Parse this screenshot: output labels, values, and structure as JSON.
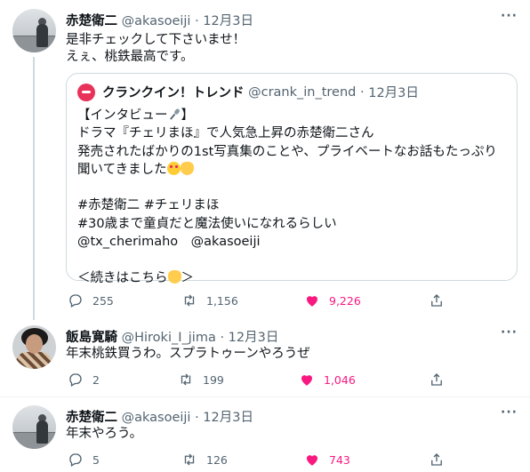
{
  "tweets": [
    {
      "name": "赤楚衛二",
      "handle": "@akasoeiji",
      "separator": "·",
      "date": "12月3日",
      "text_lines": [
        "是非チェックして下さいませ！",
        "えぇ、桃鉄最高です。"
      ],
      "quote": {
        "name": "クランクイン！トレンド",
        "handle": "@crank_in_trend",
        "separator": "·",
        "date": "12月3日",
        "lines": [
          "【インタビュー",
          "】",
          "ドラマ『チェリまほ』で人気急上昇の赤楚衛二さん",
          "発売されたばかりの1st写真集のことや、プライベートなお話もたっぷり",
          "聞いてきました",
          "",
          "#赤楚衛二 #チェリまほ",
          "#30歳まで童貞だと魔法使いになれるらしい",
          "@tx_cherimaho　@akasoeiji",
          "",
          "＜続きはこちら",
          "＞"
        ]
      },
      "replies": "255",
      "retweets": "1,156",
      "likes": "9,226"
    },
    {
      "name": "飯島寛騎",
      "handle": "@Hiroki_I_jima",
      "separator": "·",
      "date": "12月3日",
      "text_lines": [
        "年末桃鉄買うわ。スプラトゥーンやろうぜ"
      ],
      "replies": "2",
      "retweets": "199",
      "likes": "1,046"
    },
    {
      "name": "赤楚衛二",
      "handle": "@akasoeiji",
      "separator": "·",
      "date": "12月3日",
      "text_lines": [
        "年末やろう。"
      ],
      "replies": "5",
      "retweets": "126",
      "likes": "743"
    }
  ],
  "more_label": "···",
  "colors": {
    "like": "#f91880",
    "muted": "#536471",
    "border": "#cfd9de"
  }
}
